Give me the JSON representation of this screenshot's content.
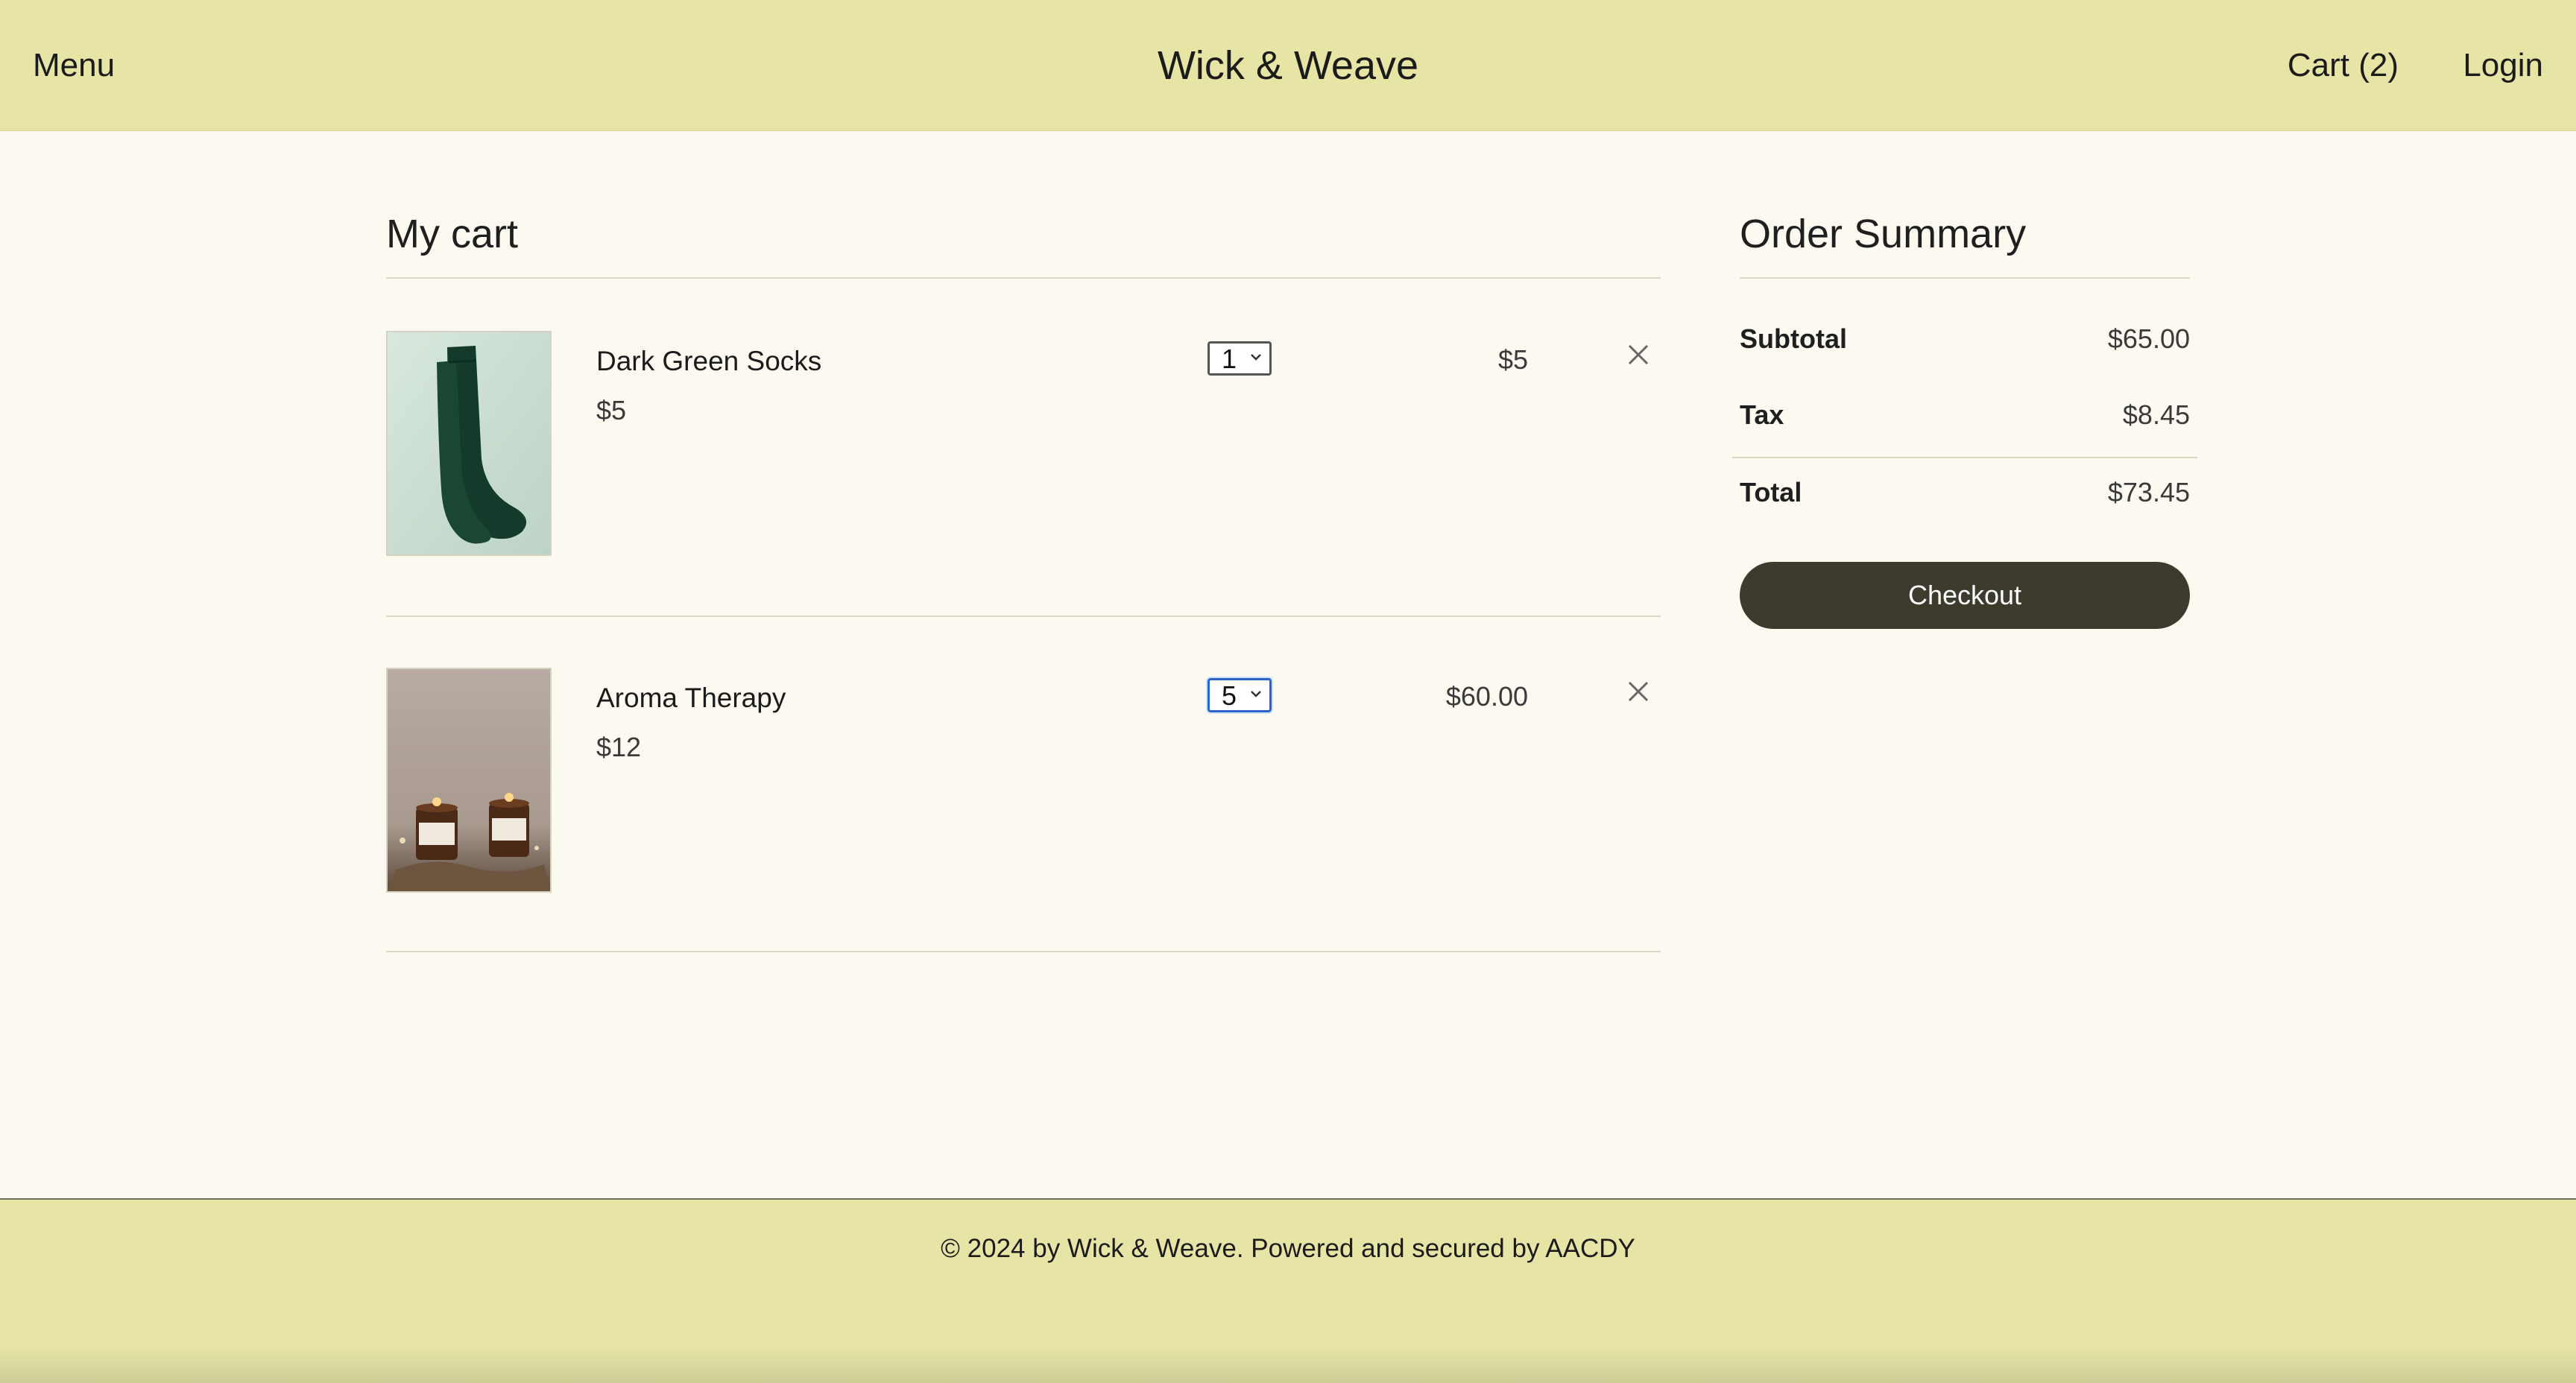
{
  "header": {
    "menu_label": "Menu",
    "brand": "Wick & Weave",
    "cart_label": "Cart (2)",
    "login_label": "Login"
  },
  "cart": {
    "title": "My cart",
    "items": [
      {
        "name": "Dark Green Socks",
        "unit_price": "$5",
        "quantity": "1",
        "line_total": "$5",
        "image_icon": "dark-green-socks-photo"
      },
      {
        "name": "Aroma Therapy",
        "unit_price": "$12",
        "quantity": "5",
        "line_total": "$60.00",
        "image_icon": "candles-photo"
      }
    ]
  },
  "summary": {
    "title": "Order Summary",
    "subtotal_label": "Subtotal",
    "subtotal_value": "$65.00",
    "tax_label": "Tax",
    "tax_value": "$8.45",
    "total_label": "Total",
    "total_value": "$73.45",
    "checkout_label": "Checkout"
  },
  "footer": {
    "text": "© 2024 by Wick & Weave. Powered and secured by AACDY"
  },
  "colors": {
    "header_bg": "#e6e5a6",
    "page_bg": "#fcf9f0",
    "checkout_bg": "#3c3b2e",
    "focus_blue": "#2a63c9"
  }
}
